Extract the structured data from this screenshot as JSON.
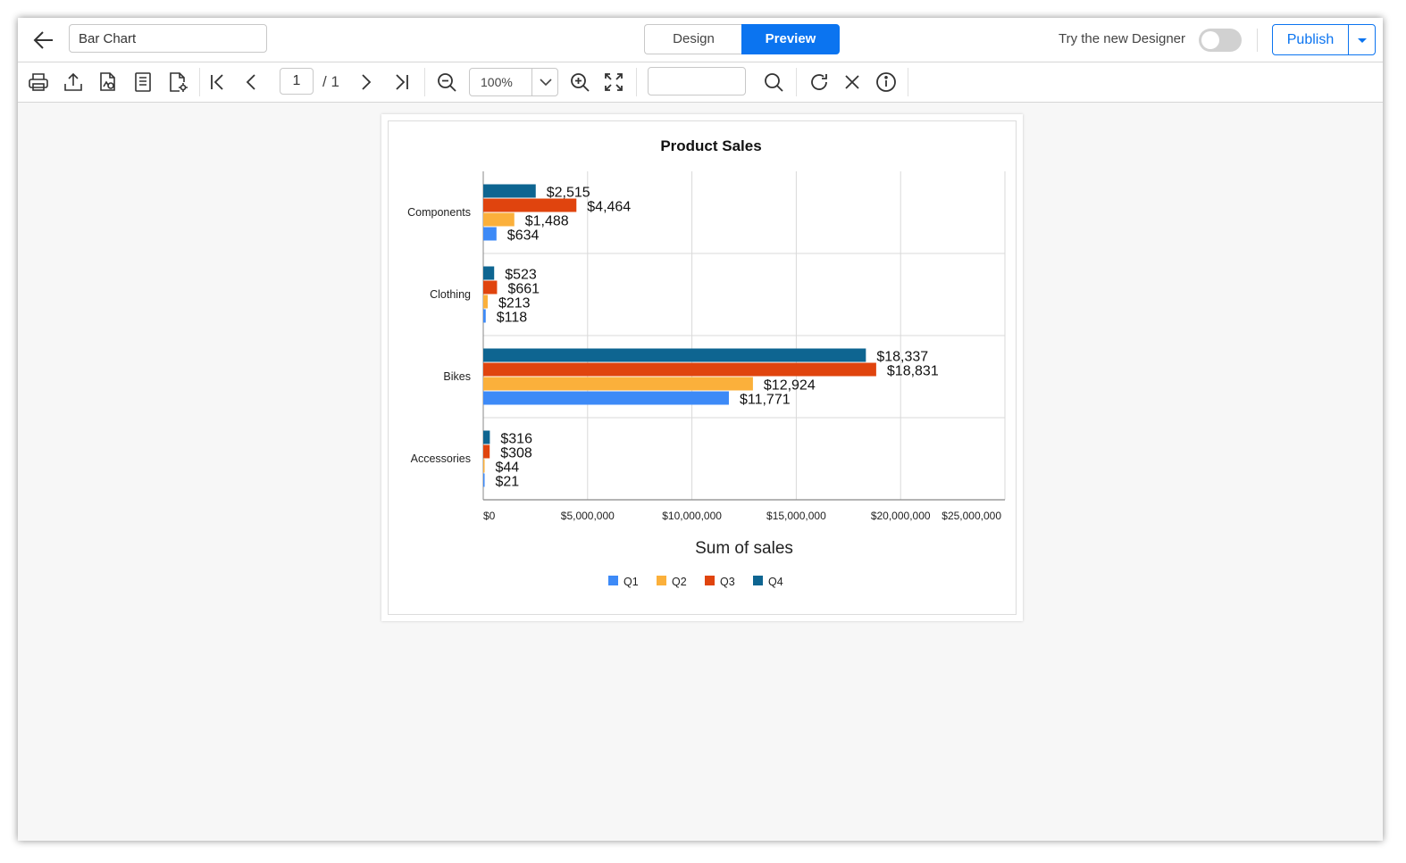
{
  "header": {
    "report_name": "Bar Chart",
    "design_tab": "Design",
    "preview_tab": "Preview",
    "try_new_designer": "Try the new Designer",
    "publish": "Publish"
  },
  "toolbar": {
    "current_page": "1",
    "total_pages": "/ 1",
    "zoom": "100%",
    "search_value": ""
  },
  "colors": {
    "accent": "#0b74f0",
    "q1": "#3d8af7",
    "q2": "#fbb03b",
    "q3": "#e0440e",
    "q4": "#0e6591"
  },
  "chart_data": {
    "type": "bar",
    "orientation": "horizontal",
    "title": "Product Sales",
    "xlabel": "Sum of sales",
    "ylabel": "",
    "categories": [
      "Components",
      "Clothing",
      "Bikes",
      "Accessories"
    ],
    "series": [
      {
        "name": "Q1",
        "color": "#3d8af7",
        "values": [
          634000,
          118000,
          11771000,
          21000
        ],
        "labels": [
          "$634",
          "$118",
          "$11,771",
          "$21"
        ]
      },
      {
        "name": "Q2",
        "color": "#fbb03b",
        "values": [
          1488000,
          213000,
          12924000,
          44000
        ],
        "labels": [
          "$1,488",
          "$213",
          "$12,924",
          "$44"
        ]
      },
      {
        "name": "Q3",
        "color": "#e0440e",
        "values": [
          4464000,
          661000,
          18831000,
          308000
        ],
        "labels": [
          "$4,464",
          "$661",
          "$18,831",
          "$308"
        ]
      },
      {
        "name": "Q4",
        "color": "#0e6591",
        "values": [
          2515000,
          523000,
          18337000,
          316000
        ],
        "labels": [
          "$2,515",
          "$523",
          "$18,337",
          "$316"
        ]
      }
    ],
    "xlim": [
      0,
      25000000
    ],
    "xticks": [
      "$0",
      "$5,000,000",
      "$10,000,000",
      "$15,000,000",
      "$20,000,000",
      "$25,000,000"
    ],
    "grid": true,
    "legend": "bottom"
  }
}
